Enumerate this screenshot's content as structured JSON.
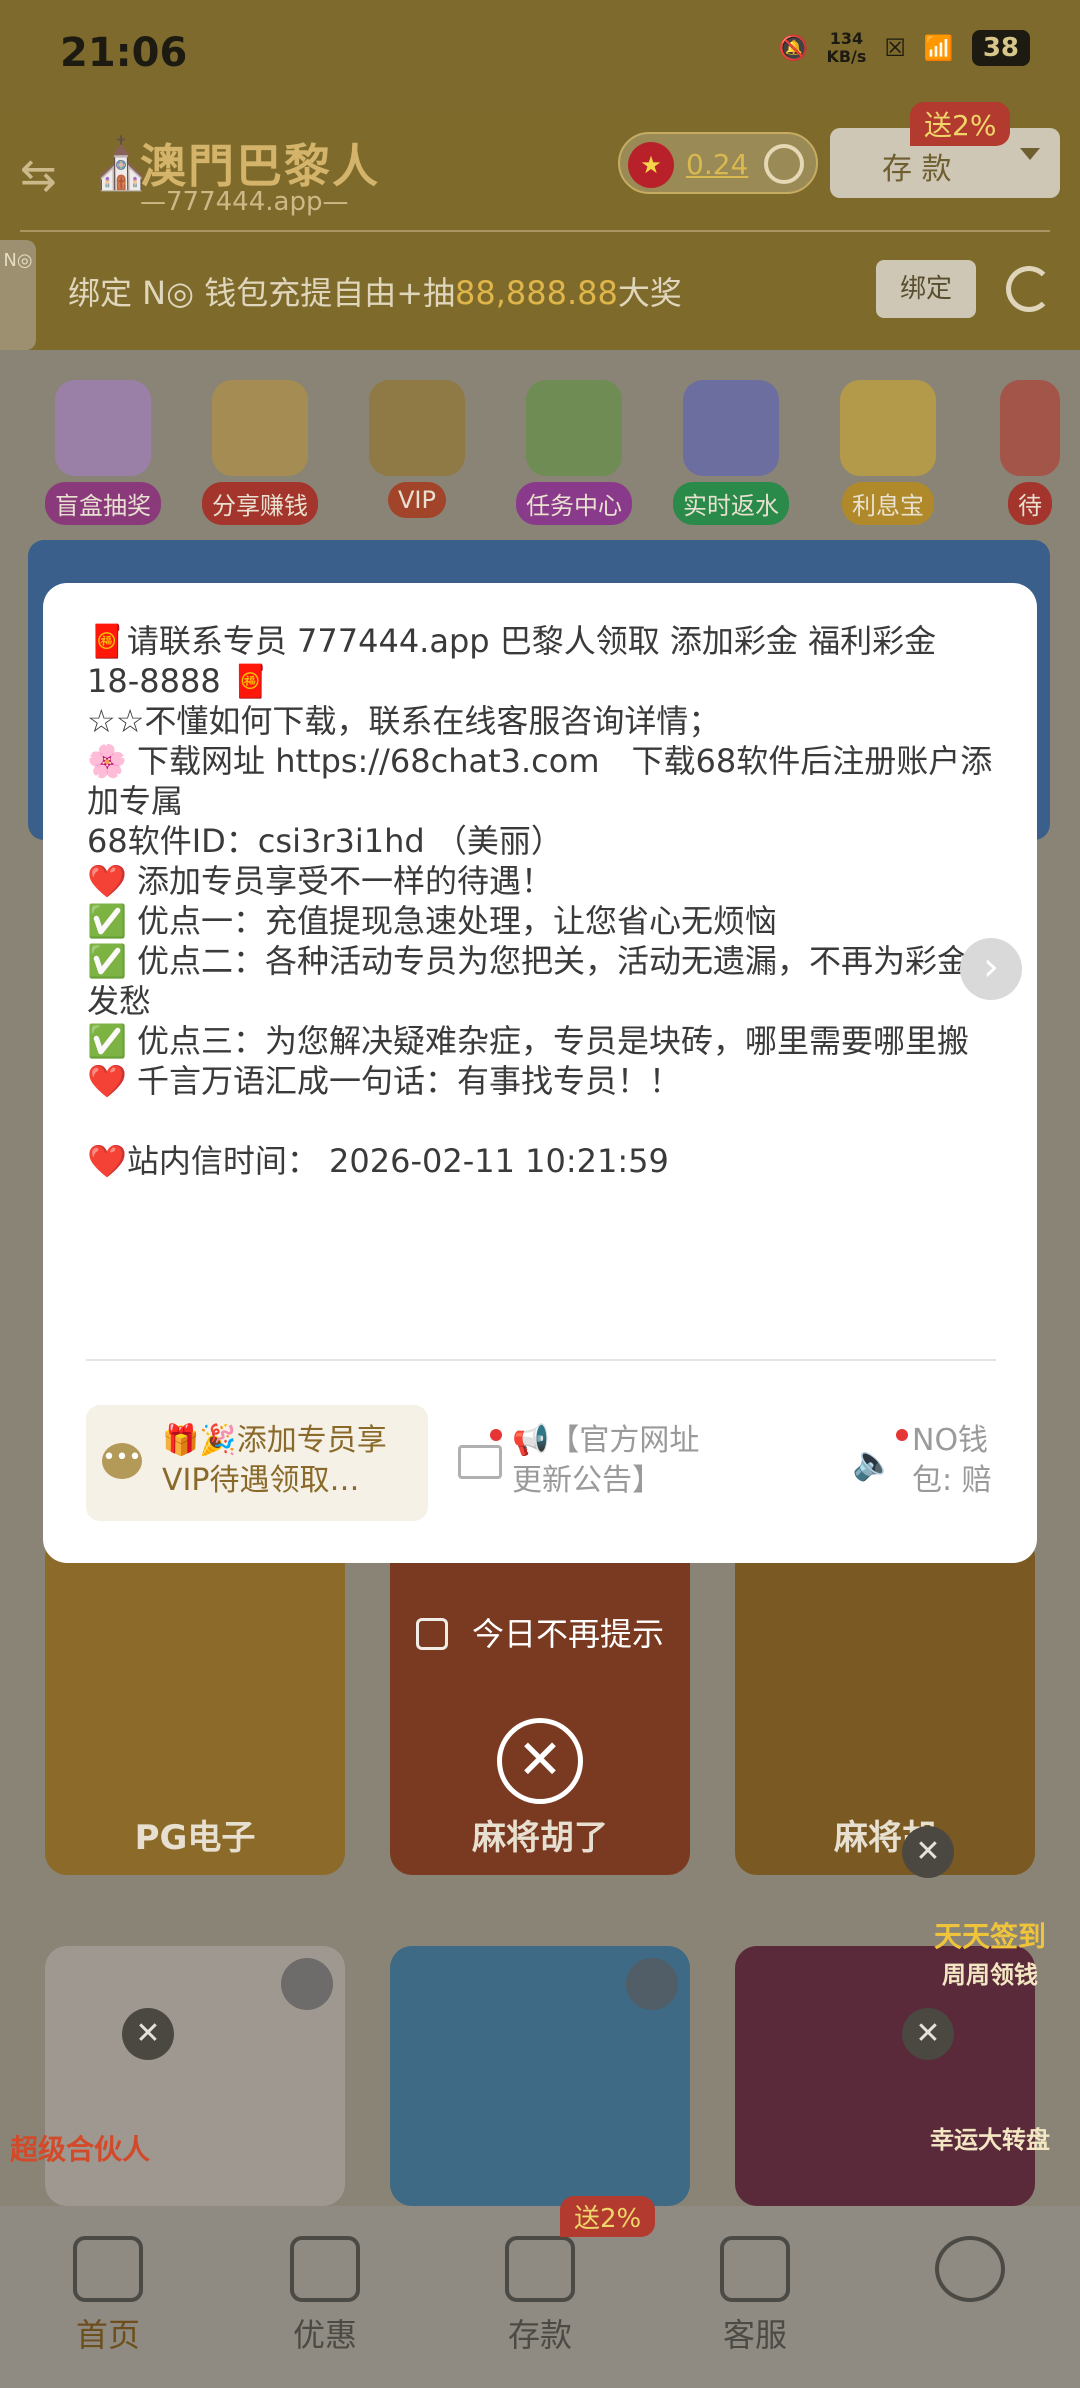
{
  "status_bar": {
    "time": "21:06",
    "net_speed_value": "134",
    "net_speed_unit": "KB/s",
    "battery": "38"
  },
  "header": {
    "logo_title": "澳門巴黎人",
    "logo_sub": "—777444.app—",
    "balance": "0.24",
    "deposit_label": "存 款",
    "deposit_badge": "送2%",
    "side_tab": "N◎",
    "promo_prefix": "绑定 N◎ 钱包充提自由+抽",
    "promo_amount": "88,888.88",
    "promo_suffix": "大奖",
    "bind_label": "绑定"
  },
  "features": [
    {
      "label": "盲盒抽奖",
      "color": "#8a3a7a"
    },
    {
      "label": "分享赚钱",
      "color": "#a3352c"
    },
    {
      "label": "VIP",
      "color": "#a1442a"
    },
    {
      "label": "任务中心",
      "color": "#8a3a8a"
    },
    {
      "label": "实时返水",
      "color": "#2a8a4a"
    },
    {
      "label": "利息宝",
      "color": "#b08a2a"
    },
    {
      "label": "待",
      "color": "#a3352c"
    }
  ],
  "modal": {
    "lines": [
      "🧧请联系专员 777444.app 巴黎人领取 添加彩金 福利彩金 18-8888 🧧",
      "☆☆不懂如何下载，联系在线客服咨询详情；",
      "🌸 下载网址 https://68chat3.com　下载68软件后注册账户添加专属",
      "68软件ID：csi3r3i1hd （美丽）",
      "❤️ 添加专员享受不一样的待遇！",
      "✅ 优点一：充值提现急速处理，让您省心无烦恼",
      "✅ 优点二：各种活动专员为您把关，活动无遗漏，不再为彩金发愁",
      "✅ 优点三：为您解决疑难杂症，专员是块砖，哪里需要哪里搬",
      "❤️ 千言万语汇成一句话：有事找专员！！",
      "",
      "❤️站内信时间： 2026-02-11  10:21:59"
    ],
    "tabs": [
      {
        "label": "🎁🎉添加专员享VIP待遇领取…"
      },
      {
        "label": "📢【官方网址更新公告】"
      },
      {
        "label": "NO钱包: 赔"
      }
    ],
    "dont_show_today": "今日不再提示"
  },
  "games": [
    {
      "label": "PG电子"
    },
    {
      "label": "麻将胡了"
    },
    {
      "label": "麻将胡"
    }
  ],
  "floaters": {
    "left_label": "超级合伙人",
    "right_top_label": "天天签到",
    "right_mid_label": "周周领钱",
    "right_bottom_label": "幸运大转盘"
  },
  "bottom_nav": [
    {
      "label": "首页"
    },
    {
      "label": "优惠"
    },
    {
      "label": "存款",
      "badge": "送2%"
    },
    {
      "label": "客服"
    },
    {
      "label": ""
    }
  ]
}
